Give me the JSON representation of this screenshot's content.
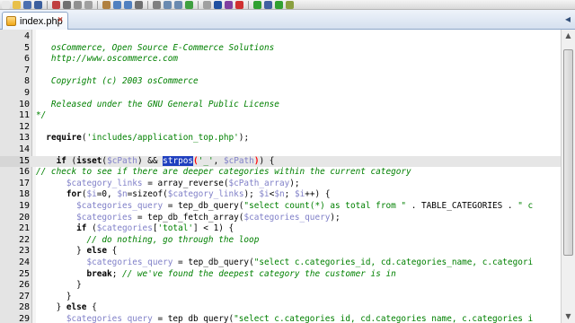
{
  "toolbar": {
    "icons": [
      {
        "name": "new-file-icon",
        "color": "#e8e8e8"
      },
      {
        "name": "open-folder-icon",
        "color": "#e8c04a"
      },
      {
        "name": "save-icon",
        "color": "#4a6fb0"
      },
      {
        "name": "save-all-icon",
        "color": "#3b5f9e"
      },
      {
        "name": "close-icon",
        "color": "#c04040"
      },
      {
        "name": "print-icon",
        "color": "#707070"
      },
      {
        "name": "cut-icon",
        "color": "#909090"
      },
      {
        "name": "copy-icon",
        "color": "#a0a0a0"
      },
      {
        "name": "paste-icon",
        "color": "#b08040"
      },
      {
        "name": "undo-icon",
        "color": "#5080c0"
      },
      {
        "name": "redo-icon",
        "color": "#5080c0"
      },
      {
        "name": "find-icon",
        "color": "#707070"
      },
      {
        "name": "replace-icon",
        "color": "#808080"
      },
      {
        "name": "zoom-in-icon",
        "color": "#6a8ab0"
      },
      {
        "name": "zoom-out-icon",
        "color": "#6a8ab0"
      },
      {
        "name": "sync-icon",
        "color": "#40a040"
      },
      {
        "name": "word-wrap-icon",
        "color": "#a0a0a0"
      },
      {
        "name": "indent-guide-icon",
        "color": "#2050a0"
      },
      {
        "name": "show-all-icon",
        "color": "#8040a0"
      },
      {
        "name": "macro-record-icon",
        "color": "#d03030"
      },
      {
        "name": "macro-play-icon",
        "color": "#30a030"
      },
      {
        "name": "macro-save-icon",
        "color": "#4060a0"
      },
      {
        "name": "run-icon",
        "color": "#30a030"
      },
      {
        "name": "plugin-icon",
        "color": "#8aa040"
      }
    ]
  },
  "tabs": [
    {
      "label": "index.php",
      "close": "×"
    }
  ],
  "tab_scroll_left": "◂",
  "editor": {
    "current_line": 15,
    "lines": [
      {
        "num": "4",
        "html": ""
      },
      {
        "num": "5",
        "html": "<span class=\"cm\">   osCommerce, Open Source E-Commerce Solutions</span>"
      },
      {
        "num": "6",
        "html": "<span class=\"cm\">   http://www.oscommerce.com</span>"
      },
      {
        "num": "7",
        "html": ""
      },
      {
        "num": "8",
        "html": "<span class=\"cm\">   Copyright (c) 2003 osCommerce</span>"
      },
      {
        "num": "9",
        "html": ""
      },
      {
        "num": "10",
        "html": "<span class=\"cm\">   Released under the GNU General Public License</span>"
      },
      {
        "num": "11",
        "html": "<span class=\"cm\">*/</span>"
      },
      {
        "num": "12",
        "html": ""
      },
      {
        "num": "13",
        "html": "  <span class=\"kw\">require</span>(<span class=\"st\">'includes/application_top.php'</span>);"
      },
      {
        "num": "14",
        "html": ""
      },
      {
        "num": "15",
        "html": "    <span class=\"kw\">if</span> (<span class=\"kw\">isset</span>(<span class=\"vr\">$cPath</span>) &amp;&amp; <span class=\"hl\">strpos</span><span class=\"brk\">(</span><span class=\"st\">'_'</span>, <span class=\"vr\">$cPath</span><span class=\"brk\">)</span>) {"
      },
      {
        "num": "16",
        "html": "<span class=\"cm\">// check to see if there are deeper categories within the current category</span>"
      },
      {
        "num": "17",
        "html": "      <span class=\"vr\">$category_links</span> = array_reverse(<span class=\"vr\">$cPath_array</span>);"
      },
      {
        "num": "18",
        "html": "      <span class=\"kw\">for</span>(<span class=\"vr\">$i</span>=0, <span class=\"vr\">$n</span>=sizeof(<span class=\"vr\">$category_links</span>); <span class=\"vr\">$i</span>&lt;<span class=\"vr\">$n</span>; <span class=\"vr\">$i</span>++) {"
      },
      {
        "num": "19",
        "html": "        <span class=\"vr\">$categories_query</span> = tep_db_query(<span class=\"st\">\"select count(*) as total from \"</span> . TABLE_CATEGORIES . <span class=\"st\">\" c</span>"
      },
      {
        "num": "20",
        "html": "        <span class=\"vr\">$categories</span> = tep_db_fetch_array(<span class=\"vr\">$categories_query</span>);"
      },
      {
        "num": "21",
        "html": "        <span class=\"kw\">if</span> (<span class=\"vr\">$categories</span>[<span class=\"st\">'total'</span>] &lt; 1) {"
      },
      {
        "num": "22",
        "html": "<span class=\"cm\">          // do nothing, go through the loop</span>"
      },
      {
        "num": "23",
        "html": "        } <span class=\"kw\">else</span> {"
      },
      {
        "num": "24",
        "html": "          <span class=\"vr\">$categories_query</span> = tep_db_query(<span class=\"st\">\"select c.categories_id, cd.categories_name, c.categori</span>"
      },
      {
        "num": "25",
        "html": "          <span class=\"kw\">break</span>; <span class=\"cm\">// we've found the deepest category the customer is in</span>"
      },
      {
        "num": "26",
        "html": "        }"
      },
      {
        "num": "27",
        "html": "      }"
      },
      {
        "num": "28",
        "html": "    } <span class=\"kw\">else</span> {"
      },
      {
        "num": "29",
        "html": "      <span class=\"vr\">$categories_query</span> = tep_db_query(<span class=\"st\">\"select c.categories_id, cd.categories_name, c.categories_i</span>"
      }
    ]
  },
  "scrollbar": {
    "up": "▲",
    "down": "▼",
    "position": 0.07
  }
}
